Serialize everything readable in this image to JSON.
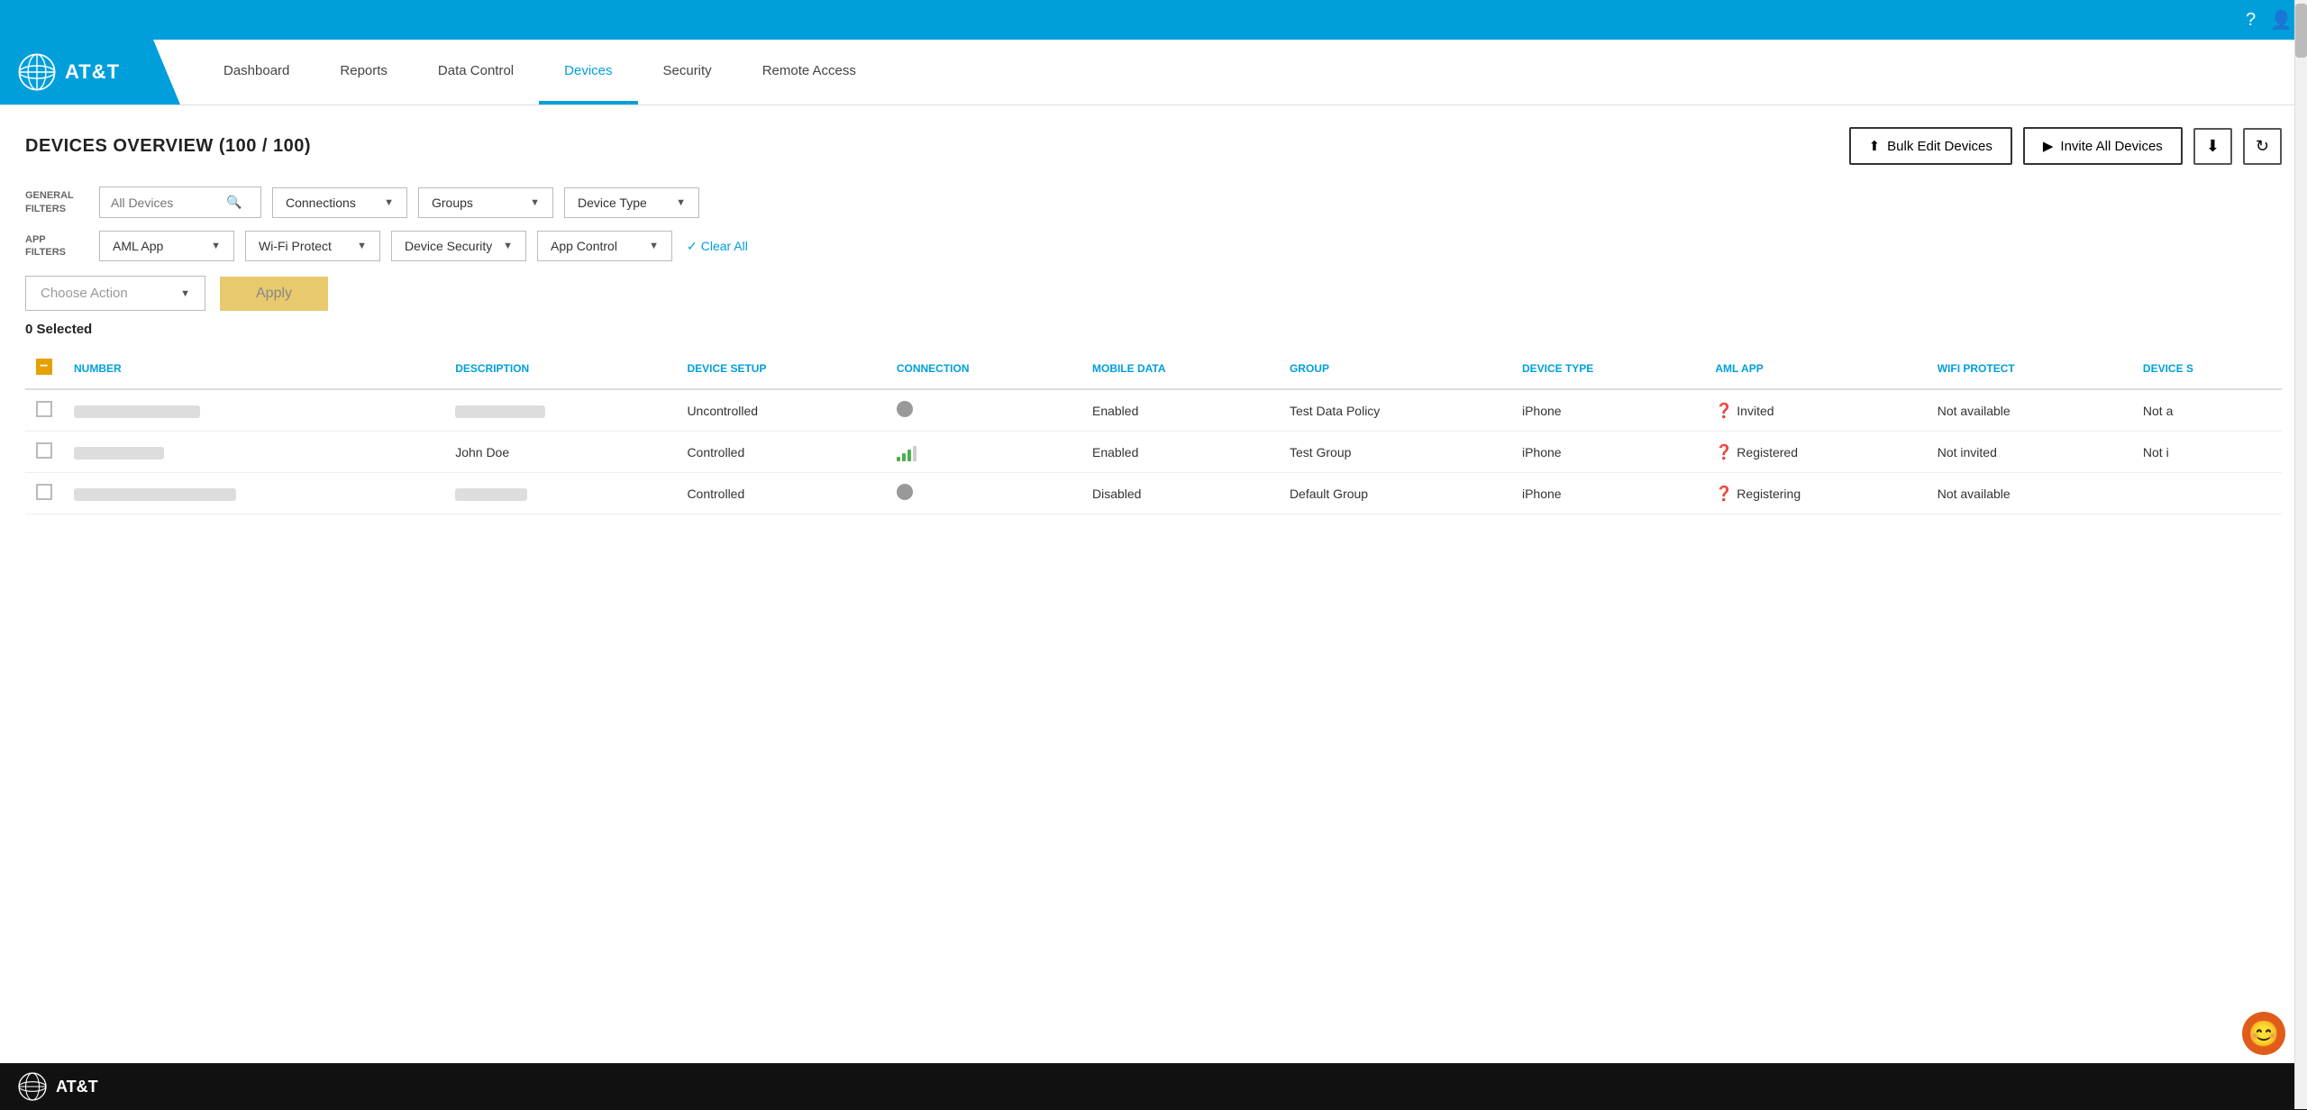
{
  "topbar": {
    "help_icon": "?",
    "user_icon": "👤"
  },
  "header": {
    "logo_text": "AT&T",
    "nav_tabs": [
      {
        "label": "Dashboard",
        "active": false
      },
      {
        "label": "Reports",
        "active": false
      },
      {
        "label": "Data Control",
        "active": false
      },
      {
        "label": "Devices",
        "active": true
      },
      {
        "label": "Security",
        "active": false
      },
      {
        "label": "Remote Access",
        "active": false
      }
    ]
  },
  "page": {
    "title": "DEVICES OVERVIEW (100 / 100)",
    "bulk_edit_label": "Bulk Edit Devices",
    "invite_all_label": "Invite All Devices"
  },
  "general_filters": {
    "label": "GENERAL FILTERS",
    "search_placeholder": "All Devices",
    "connections_label": "Connections",
    "groups_label": "Groups",
    "device_type_label": "Device Type"
  },
  "app_filters": {
    "label": "APP FILTERS",
    "aml_app_label": "AML App",
    "wifi_protect_label": "Wi-Fi Protect",
    "device_security_label": "Device Security",
    "app_control_label": "App Control",
    "clear_all_label": "Clear All"
  },
  "action_row": {
    "choose_action_placeholder": "Choose Action",
    "apply_label": "Apply"
  },
  "selected_count": "0 Selected",
  "table": {
    "headers": [
      "NUMBER",
      "DESCRIPTION",
      "DEVICE SETUP",
      "CONNECTION",
      "MOBILE DATA",
      "GROUP",
      "DEVICE TYPE",
      "AML APP",
      "WIFI PROTECT",
      "DEVICE S"
    ],
    "rows": [
      {
        "number_redacted": true,
        "number_width": "140",
        "description": "",
        "desc_redacted": true,
        "desc_width": "100",
        "device_setup": "Uncontrolled",
        "connection": "dot",
        "mobile_data": "Enabled",
        "group": "Test Data Policy",
        "device_type": "iPhone",
        "aml_app": "Invited",
        "wifi_protect": "Not available",
        "device_security": "Not a"
      },
      {
        "number_redacted": true,
        "number_width": "100",
        "description": "John Doe",
        "desc_redacted": false,
        "device_setup": "Controlled",
        "connection": "bars",
        "mobile_data": "Enabled",
        "group": "Test Group",
        "device_type": "iPhone",
        "aml_app": "Registered",
        "wifi_protect": "Not invited",
        "device_security": "Not i"
      },
      {
        "number_redacted": true,
        "number_width": "180",
        "description": "",
        "desc_redacted": true,
        "desc_width": "80",
        "device_setup": "Controlled",
        "connection": "dot",
        "mobile_data": "Disabled",
        "group": "Default Group",
        "device_type": "iPhone",
        "aml_app": "Registering",
        "wifi_protect": "Not available",
        "device_security": ""
      }
    ]
  },
  "footer": {
    "logo_text": "AT&T"
  }
}
